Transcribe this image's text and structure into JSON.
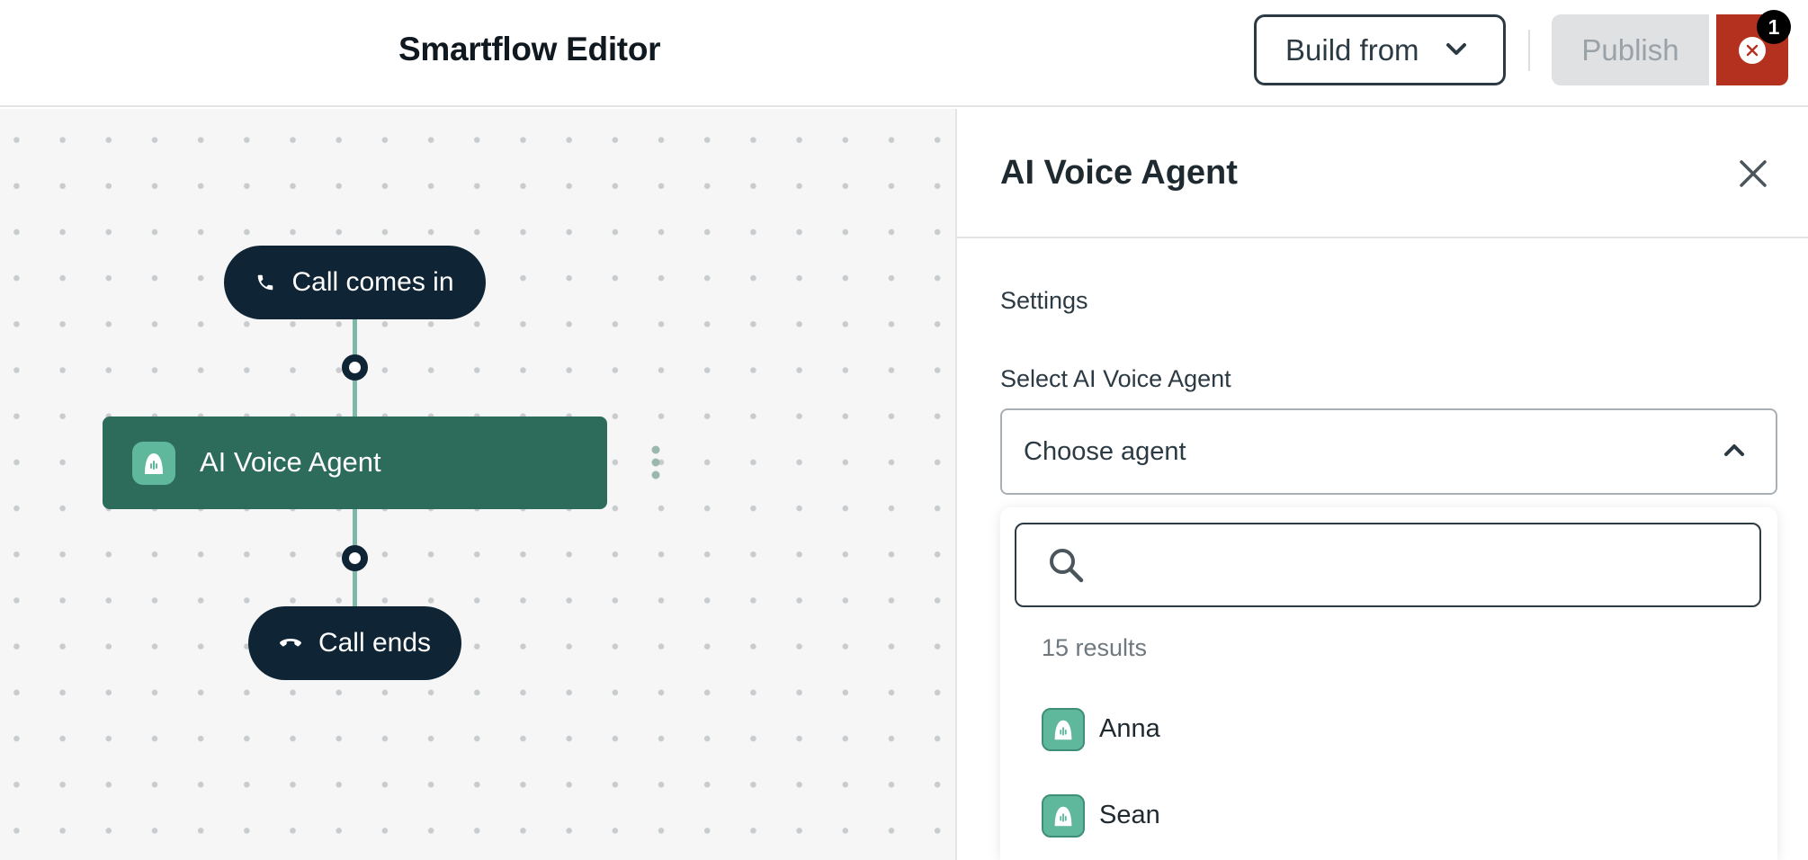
{
  "header": {
    "title": "Smartflow Editor",
    "build_from_label": "Build from",
    "publish_label": "Publish",
    "error_count": "1"
  },
  "flow": {
    "start_node": {
      "label": "Call comes in",
      "icon": "phone-icon"
    },
    "agent_node": {
      "label": "AI Voice Agent",
      "icon": "ai-agent-icon"
    },
    "end_node": {
      "label": "Call ends",
      "icon": "hang-up-icon"
    }
  },
  "panel": {
    "title": "AI Voice Agent",
    "settings_label": "Settings",
    "select_label": "Select AI Voice Agent",
    "select_placeholder": "Choose agent",
    "search_value": "",
    "results_count": "15 results",
    "options": [
      {
        "name": "Anna"
      },
      {
        "name": "Sean"
      }
    ]
  },
  "colors": {
    "node_dark": "#0f2535",
    "agent_green": "#2d6b5b",
    "agent_icon_green": "#5fb89c",
    "error_red": "#b5311f",
    "connector": "#7eb8ab"
  }
}
